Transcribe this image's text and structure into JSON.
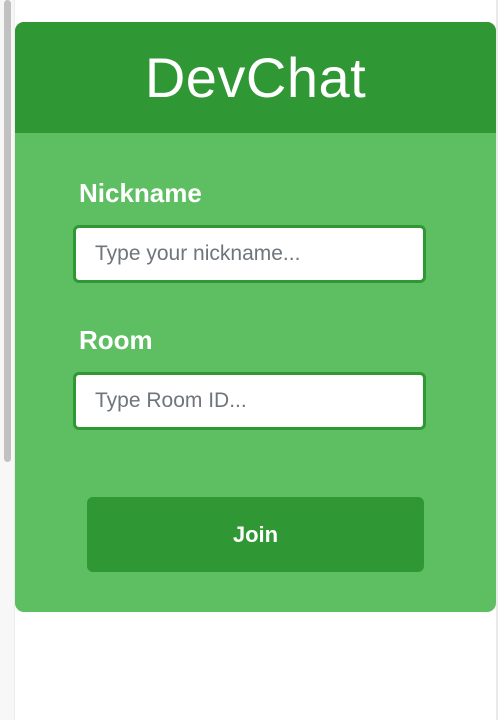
{
  "app": {
    "title": "DevChat"
  },
  "form": {
    "nickname": {
      "label": "Nickname",
      "value": "",
      "placeholder": "Type your nickname..."
    },
    "room": {
      "label": "Room",
      "value": "",
      "placeholder": "Type Room ID..."
    },
    "join_label": "Join"
  },
  "colors": {
    "card_background": "#5dbf62",
    "accent": "#2f9834",
    "text_on_accent": "#ffffff"
  }
}
